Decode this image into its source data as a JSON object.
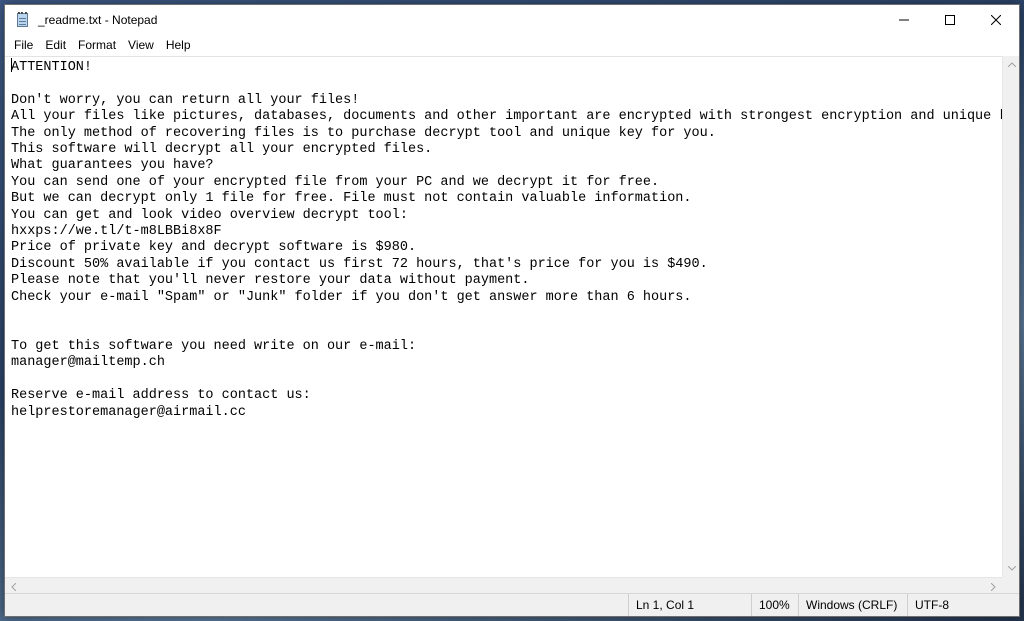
{
  "window": {
    "title": "_readme.txt - Notepad",
    "icon": "notepad-icon"
  },
  "controls": {
    "minimize_icon": "minimize-icon",
    "maximize_icon": "maximize-icon",
    "close_icon": "close-icon"
  },
  "menu": [
    "File",
    "Edit",
    "Format",
    "View",
    "Help"
  ],
  "document": {
    "lines": [
      "ATTENTION!",
      "",
      "Don't worry, you can return all your files!",
      "All your files like pictures, databases, documents and other important are encrypted with strongest encryption and unique key.",
      "The only method of recovering files is to purchase decrypt tool and unique key for you.",
      "This software will decrypt all your encrypted files.",
      "What guarantees you have?",
      "You can send one of your encrypted file from your PC and we decrypt it for free.",
      "But we can decrypt only 1 file for free. File must not contain valuable information.",
      "You can get and look video overview decrypt tool:",
      "hxxps://we.tl/t-m8LBBi8x8F",
      "Price of private key and decrypt software is $980.",
      "Discount 50% available if you contact us first 72 hours, that's price for you is $490.",
      "Please note that you'll never restore your data without payment.",
      "Check your e-mail \"Spam\" or \"Junk\" folder if you don't get answer more than 6 hours.",
      "",
      "",
      "To get this software you need write on our e-mail:",
      "manager@mailtemp.ch",
      "",
      "Reserve e-mail address to contact us:",
      "helprestoremanager@airmail.cc"
    ]
  },
  "status": {
    "position": "Ln 1, Col 1",
    "zoom": "100%",
    "line_ending": "Windows (CRLF)",
    "encoding": "UTF-8"
  }
}
